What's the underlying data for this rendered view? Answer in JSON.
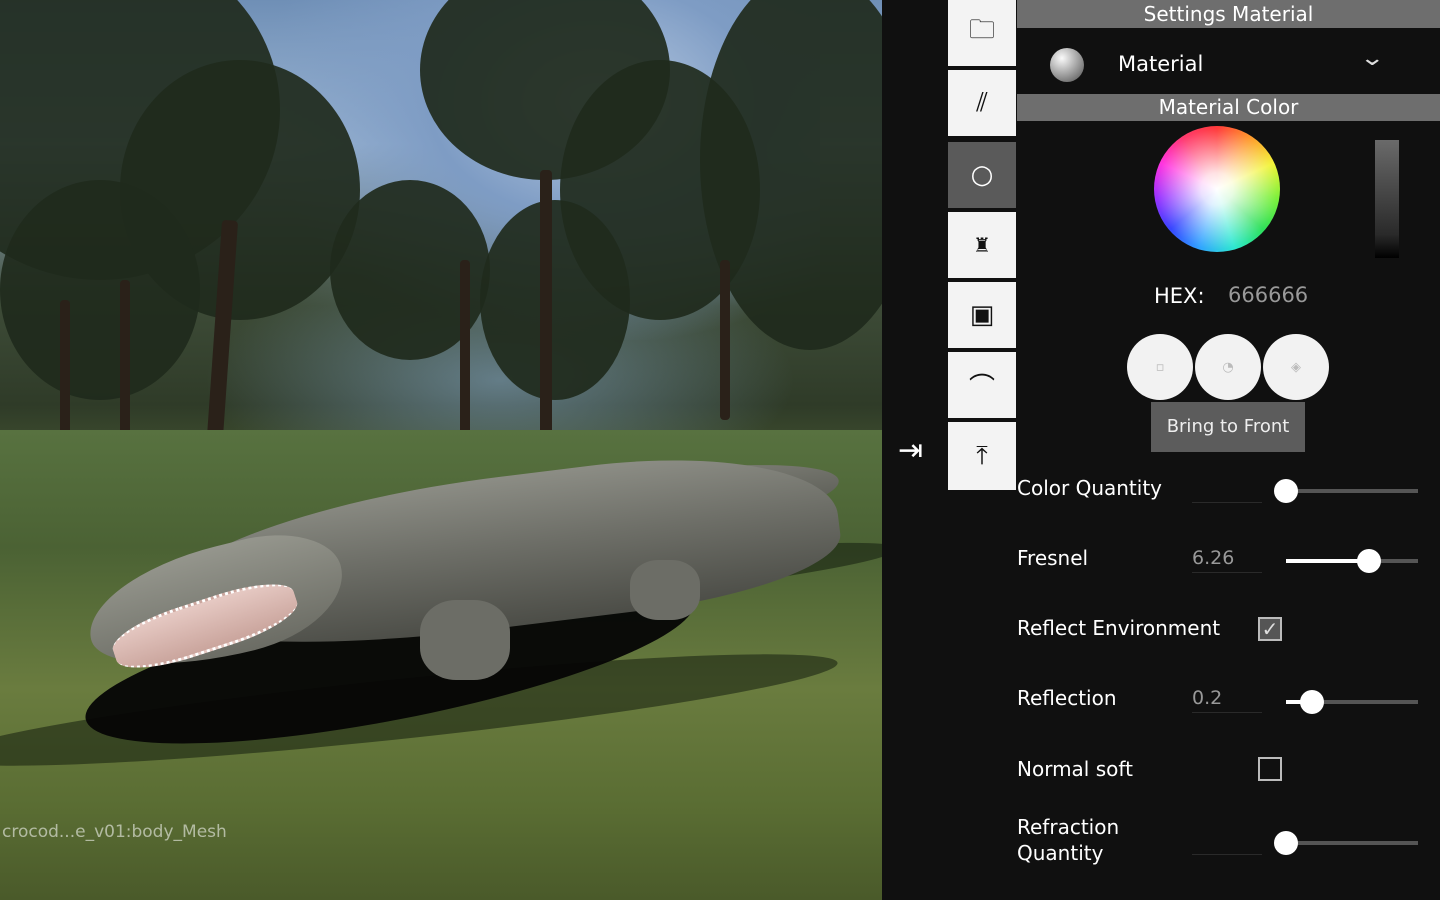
{
  "viewport": {
    "scene_label": "crocod...e_v01:body_Mesh"
  },
  "toggle": {
    "icon": "arrow-right-to-bar-icon",
    "glyph": "⇥"
  },
  "toolbar": {
    "buttons": [
      {
        "name": "folder",
        "glyph": "🗀"
      },
      {
        "name": "texture-hatch",
        "glyph": "⫽"
      },
      {
        "name": "material-sphere",
        "glyph": "○",
        "active": true
      },
      {
        "name": "lighting",
        "glyph": "♜"
      },
      {
        "name": "image-add",
        "glyph": "▣"
      },
      {
        "name": "environment-arc",
        "glyph": "⌒"
      },
      {
        "name": "export-upload",
        "glyph": "⤒"
      }
    ]
  },
  "settings": {
    "header": "Settings Material",
    "material_label": "Material",
    "chevron": "⌄",
    "color_header": "Material Color",
    "hex_label": "HEX:",
    "hex_value": "666666",
    "tooltip": "Bring to Front",
    "properties": {
      "color_quantity": {
        "label": "Color Quantity",
        "value": 0.0
      },
      "fresnel": {
        "label": "Fresnel",
        "value_text": "6.26",
        "value": 0.63
      },
      "reflect_environment": {
        "label": "Reflect Environment",
        "checked": true,
        "check_glyph": "✓"
      },
      "reflection": {
        "label": "Reflection",
        "value_text": "0.2",
        "value": 0.2
      },
      "normal_soft": {
        "label": "Normal soft",
        "checked": false
      },
      "refraction_quantity": {
        "label": "Refraction\nQuantity",
        "value": 0.0
      }
    }
  }
}
